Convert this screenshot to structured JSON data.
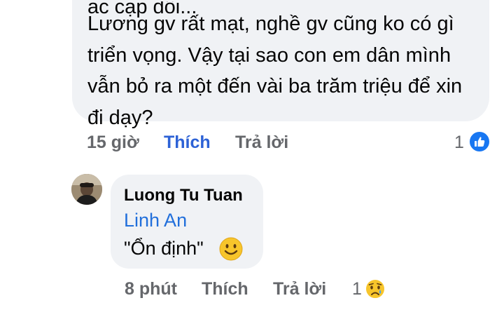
{
  "top_comment": {
    "cut_line": "ác cặp đôi...",
    "text": "Lương gv rất mạt, nghề gv cũng ko có gì triển vọng. Vậy tại sao con em dân mình vẫn bỏ ra một đến vài ba trăm triệu để xin đi dạy?",
    "time": "15 giờ",
    "like_label": "Thích",
    "reply_label": "Trả lời",
    "reaction_count": "1",
    "reaction_icon": "like-icon",
    "like_active_color": "#2d62d6"
  },
  "reply": {
    "author": "Luong Tu Tuan",
    "mention": "Linh An",
    "text": "\"Ổn định\"",
    "emoji_icon": "smile-emoji-icon",
    "time": "8 phút",
    "like_label": "Thích",
    "reply_label": "Trả lời",
    "reaction_count": "1",
    "reaction_icon": "sad-reaction-icon"
  }
}
